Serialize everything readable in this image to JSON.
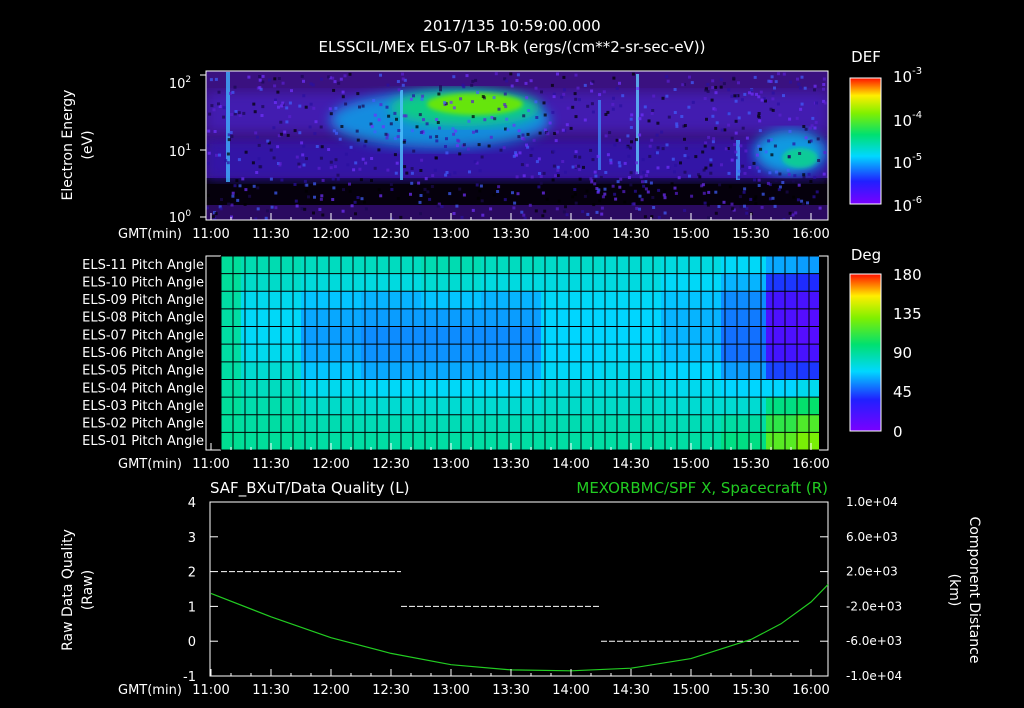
{
  "header": {
    "timestamp": "2017/135 10:59:00.000",
    "title": "ELSSCIL/MEx ELS-07 LR-Bk  (ergs/(cm**2-sr-sec-eV))"
  },
  "time_axis": {
    "label": "GMT(min)",
    "ticks": [
      "11:00",
      "11:30",
      "12:00",
      "12:30",
      "13:00",
      "13:30",
      "14:00",
      "14:30",
      "15:00",
      "15:30",
      "16:00"
    ]
  },
  "spectrogram": {
    "ylabel_line1": "Electron Energy",
    "ylabel_line2": "(eV)",
    "colorbar_title": "DEF",
    "colorbar_ticks": [
      {
        "base": "10",
        "exp": "-3"
      },
      {
        "base": "10",
        "exp": "-4"
      },
      {
        "base": "10",
        "exp": "-5"
      },
      {
        "base": "10",
        "exp": "-6"
      }
    ]
  },
  "pitch": {
    "colorbar_title": "Deg",
    "colorbar_ticks": [
      "180",
      "135",
      "90",
      "45",
      "0"
    ]
  },
  "quality": {
    "left_title": "SAF_BXuT/Data Quality (L)",
    "right_title": "MEXORBMC/SPF X, Spacecraft (R)",
    "ylabel_line1": "Raw Data Quality",
    "ylabel_line2": "(Raw)",
    "y2label_line1": "Component Distance",
    "y2label_line2": "(km)"
  },
  "chart_data": [
    {
      "type": "heatmap",
      "title": "ELSSCIL/MEx ELS-07 LR-Bk  (ergs/(cm**2-sr-sec-eV))",
      "xlabel": "GMT(min)",
      "ylabel": "Electron Energy (eV)",
      "yscale": "log",
      "ylim": [
        1,
        150
      ],
      "y_ticks": [
        "10^0",
        "10^1",
        "10^2"
      ],
      "colorbar": {
        "label": "DEF",
        "scale": "log",
        "range": [
          1e-06,
          0.001
        ]
      },
      "features": [
        {
          "time_range": [
            "12:10",
            "13:45"
          ],
          "energy_range": [
            25,
            90
          ],
          "level": 5e-05
        },
        {
          "time_range": [
            "13:10",
            "13:40"
          ],
          "energy_range": [
            30,
            70
          ],
          "level": 0.0001
        },
        {
          "time_range": [
            "15:35",
            "16:05"
          ],
          "energy_range": [
            4,
            20
          ],
          "level": 3e-05
        }
      ]
    },
    {
      "type": "heatmap",
      "title": "",
      "xlabel": "GMT(min)",
      "ylabel": "",
      "categories": [
        "ELS-11 Pitch Angle",
        "ELS-10 Pitch Angle",
        "ELS-09 Pitch Angle",
        "ELS-08 Pitch Angle",
        "ELS-07 Pitch Angle",
        "ELS-06 Pitch Angle",
        "ELS-05 Pitch Angle",
        "ELS-04 Pitch Angle",
        "ELS-03 Pitch Angle",
        "ELS-02 Pitch Angle",
        "ELS-01 Pitch Angle"
      ],
      "times": [
        "11:00",
        "11:30",
        "12:00",
        "12:30",
        "13:00",
        "13:30",
        "14:00",
        "14:30",
        "15:00",
        "15:30",
        "15:45",
        "16:00"
      ],
      "values": [
        [
          90,
          85,
          82,
          82,
          85,
          82,
          80,
          78,
          75,
          70,
          60,
          58
        ],
        [
          90,
          80,
          76,
          75,
          78,
          75,
          75,
          75,
          70,
          62,
          40,
          38
        ],
        [
          88,
          72,
          65,
          62,
          65,
          62,
          70,
          70,
          65,
          55,
          22,
          20
        ],
        [
          88,
          70,
          60,
          58,
          58,
          58,
          68,
          68,
          62,
          52,
          18,
          15
        ],
        [
          88,
          70,
          58,
          55,
          55,
          55,
          68,
          68,
          62,
          50,
          18,
          15
        ],
        [
          88,
          72,
          60,
          56,
          56,
          56,
          68,
          70,
          64,
          50,
          22,
          20
        ],
        [
          88,
          78,
          65,
          60,
          60,
          60,
          70,
          72,
          68,
          58,
          42,
          40
        ],
        [
          88,
          82,
          72,
          70,
          70,
          70,
          75,
          75,
          72,
          68,
          68,
          72
        ],
        [
          90,
          86,
          80,
          78,
          78,
          78,
          80,
          80,
          78,
          78,
          95,
          100
        ],
        [
          90,
          88,
          85,
          84,
          84,
          84,
          85,
          85,
          84,
          88,
          110,
          118
        ],
        [
          92,
          90,
          88,
          88,
          88,
          88,
          88,
          88,
          88,
          95,
          120,
          128
        ]
      ],
      "colorbar": {
        "label": "Deg",
        "range": [
          0,
          180
        ],
        "ticks": [
          0,
          45,
          90,
          135,
          180
        ]
      }
    },
    {
      "type": "line",
      "title": "SAF_BXuT/Data Quality (L) / MEXORBMC/SPF X, Spacecraft (R)",
      "xlabel": "GMT(min)",
      "ylabel": "Raw Data Quality (Raw)",
      "y2label": "Component Distance (km)",
      "ylim": [
        -1,
        4
      ],
      "y2lim": [
        -10000,
        10000
      ],
      "y2_ticks": [
        "1.0e+04",
        "6.0e+03",
        "2.0e+03",
        "-2.0e+03",
        "-6.0e+03",
        "-1.0e+04"
      ],
      "series": [
        {
          "name": "SAF_BXuT/Data Quality",
          "axis": "left",
          "color": "#ffffff",
          "style": "dashed",
          "segments": [
            {
              "x": [
                "11:05",
                "12:35"
              ],
              "y": 2
            },
            {
              "x": [
                "12:35",
                "14:15"
              ],
              "y": 1
            },
            {
              "x": [
                "14:15",
                "15:55"
              ],
              "y": 0
            }
          ]
        },
        {
          "name": "MEXORBMC/SPF X, Spacecraft",
          "axis": "right",
          "color": "#22cc22",
          "x": [
            "11:00",
            "11:30",
            "12:00",
            "12:30",
            "13:00",
            "13:30",
            "14:00",
            "14:30",
            "15:00",
            "15:30",
            "15:45",
            "16:00",
            "16:10"
          ],
          "y": [
            -500,
            -3200,
            -5600,
            -7400,
            -8700,
            -9300,
            -9400,
            -9100,
            -8000,
            -5800,
            -4000,
            -1500,
            500
          ]
        }
      ]
    }
  ]
}
